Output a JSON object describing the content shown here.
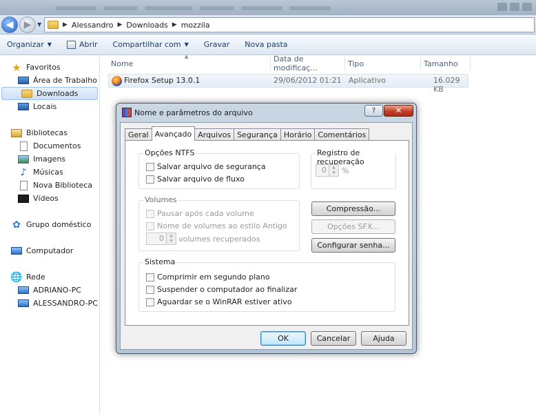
{
  "breadcrumb": [
    "Alessandro",
    "Downloads",
    "mozzila"
  ],
  "toolbar": {
    "organize": "Organizar",
    "open": "Abrir",
    "share": "Compartilhar com",
    "burn": "Gravar",
    "new_folder": "Nova pasta"
  },
  "nav": {
    "favorites": "Favoritos",
    "desktop": "Área de Trabalho",
    "downloads": "Downloads",
    "places": "Locais",
    "libraries": "Bibliotecas",
    "documents": "Documentos",
    "images": "Imagens",
    "music": "Músicas",
    "new_library": "Nova Biblioteca",
    "videos": "Vídeos",
    "homegroup": "Grupo doméstico",
    "computer": "Computador",
    "network": "Rede",
    "pc1": "ADRIANO-PC",
    "pc2": "ALESSANDRO-PC"
  },
  "filelist": {
    "columns": [
      "Nome",
      "Data de modificaç...",
      "Tipo",
      "Tamanho"
    ],
    "rows": [
      {
        "name": "Firefox Setup 13.0.1",
        "date": "29/06/2012 01:21",
        "type": "Aplicativo",
        "size": "16.029 KB"
      }
    ]
  },
  "dialog": {
    "title": "Nome e parâmetros do arquivo",
    "help_label": "?",
    "close_label": "✕",
    "tabs": [
      "Geral",
      "Avançado",
      "Arquivos",
      "Segurança",
      "Horário",
      "Comentários"
    ],
    "ntfs": {
      "label": "Opções NTFS",
      "save_security": "Salvar arquivo de segurança",
      "save_stream": "Salvar arquivo de fluxo"
    },
    "recovery": {
      "label": "Registro de recuperação",
      "value": "0",
      "unit": "%"
    },
    "volumes": {
      "label": "Volumes",
      "pause": "Pausar após cada volume",
      "old_style": "Nome de volumes ao estilo Antigo",
      "recovered_value": "0",
      "recovered_label": "volumes recuperados"
    },
    "buttons": {
      "compression": "Compressão...",
      "sfx": "Opções SFX...",
      "password": "Configurar senha...",
      "ok": "OK",
      "cancel": "Cancelar",
      "help": "Ajuda"
    },
    "system": {
      "label": "Sistema",
      "background": "Comprimir em segundo plano",
      "shutdown": "Suspender o computador ao finalizar",
      "wait": "Aguardar se o WinRAR estiver ativo"
    }
  }
}
